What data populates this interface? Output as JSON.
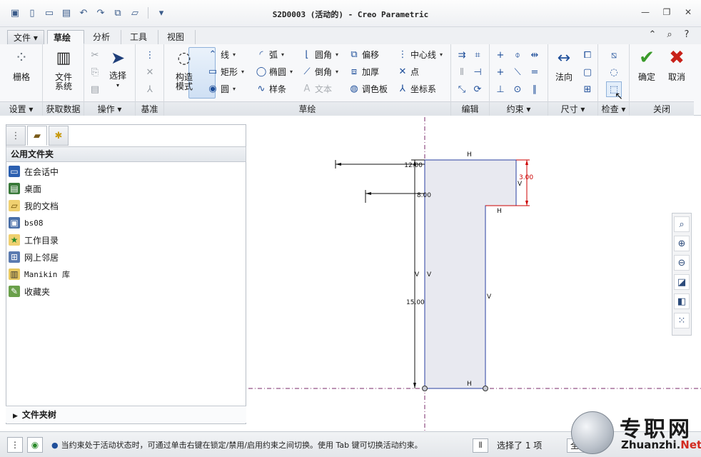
{
  "window": {
    "title": "S2D0003 (活动的) - Creo Parametric"
  },
  "tabs": [
    "文件",
    "草绘",
    "分析",
    "工具",
    "视图"
  ],
  "ribbon": {
    "grid": "栅格",
    "file_system": "文件\n系统",
    "select": "选择",
    "construction_mode": "构造\n模式",
    "line": "线",
    "rectangle": "矩形",
    "circle": "圆",
    "arc": "弧",
    "ellipse": "椭圆",
    "spline": "样条",
    "fillet": "圆角",
    "chamfer": "倒角",
    "text": "文本",
    "offset": "偏移",
    "thicken": "加厚",
    "palette": "调色板",
    "centerline": "中心线",
    "point": "点",
    "coordinate_system": "坐标系",
    "normal": "法向",
    "ok": "确定",
    "cancel": "取消",
    "groups": {
      "setup": "设置",
      "get_data": "获取数据",
      "operations": "操作",
      "datum": "基准",
      "sketch": "草绘",
      "edit": "编辑",
      "constrain": "约束",
      "dimension": "尺寸",
      "inspect": "检查",
      "close": "关闭"
    }
  },
  "folder_panel": {
    "header": "公用文件夹",
    "items": [
      "在会话中",
      "桌面",
      "我的文档",
      "bs08",
      "工作目录",
      "网上邻居",
      "Manikin 库",
      "收藏夹"
    ],
    "footer": "文件夹树"
  },
  "sketch": {
    "dim_top": "12.00",
    "dim_step": "8.00",
    "dim_right": "3.00",
    "dim_height": "15.00",
    "constraints": [
      "H",
      "H",
      "V",
      "V",
      "V",
      "V",
      "H"
    ]
  },
  "status": {
    "message": "当约束处于活动状态时，可通过单击右键在锁定/禁用/启用约束之间切换。使用 Tab 键可切换活动约束。",
    "selection": "选择了 1 项",
    "filter_value": "全部"
  },
  "watermark": {
    "cn": "专职网",
    "en": "Zhuanzhi.",
    "en_suffix": "Net"
  },
  "colors": {
    "accent": "#1f4f9a",
    "dimension_red": "#cc0000",
    "region_fill": "#e8e9f0",
    "centerline": "#7a2a6a"
  }
}
